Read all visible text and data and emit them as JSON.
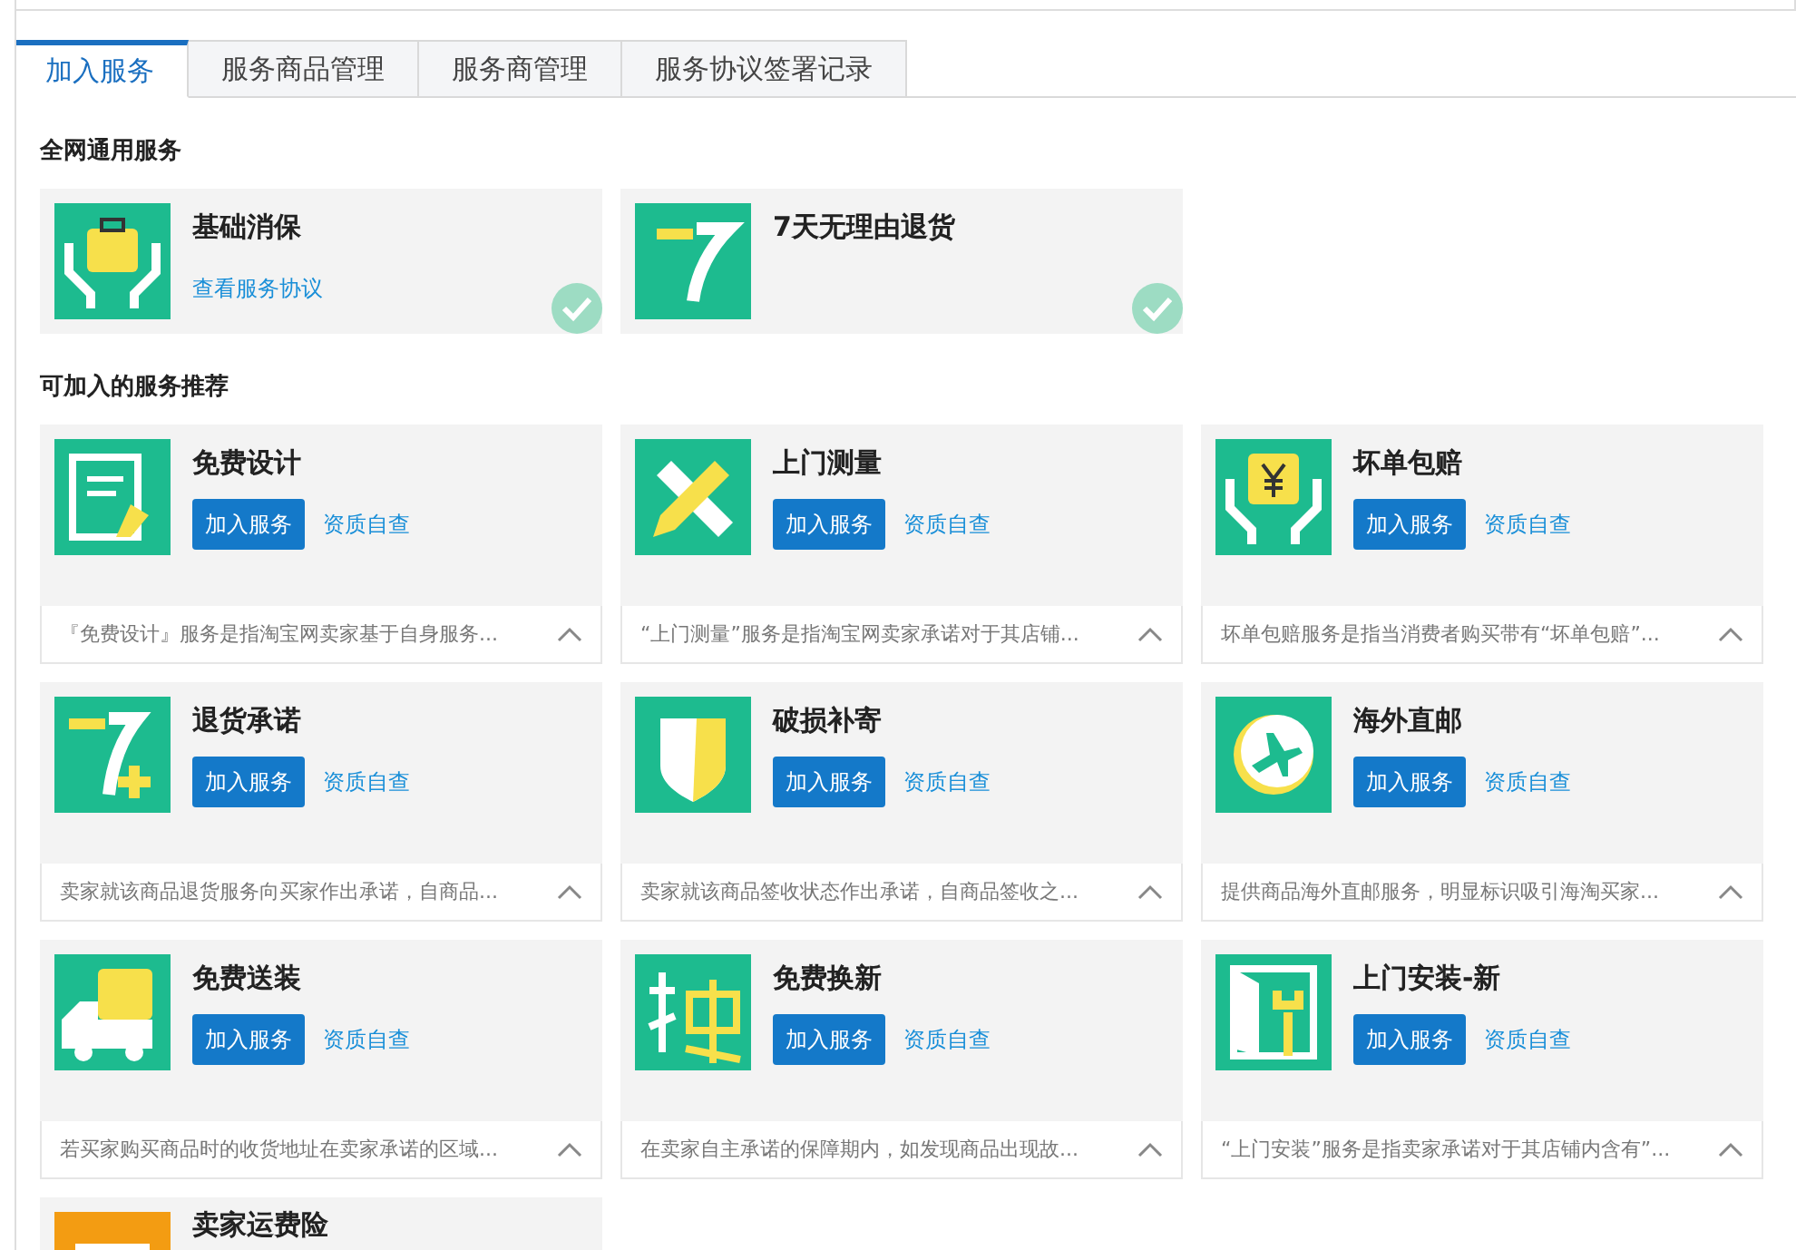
{
  "tabs": [
    {
      "label": "加入服务",
      "selected": true
    },
    {
      "label": "服务商品管理",
      "selected": false
    },
    {
      "label": "服务商管理",
      "selected": false
    },
    {
      "label": "服务协议签署记录",
      "selected": false
    }
  ],
  "general_section": {
    "title": "全网通用服务",
    "services": [
      {
        "name": "基础消保",
        "link": "查看服务协议",
        "joined": true
      },
      {
        "name": "7天无理由退货",
        "joined": true
      }
    ]
  },
  "recommended_section": {
    "title": "可加入的服务推荐",
    "services": [
      {
        "name": "免费设计",
        "join_button": "加入服务",
        "check_link": "资质自查",
        "description": "『免费设计』服务是指淘宝网卖家基于自身服务...",
        "expanded": true
      },
      {
        "name": "上门测量",
        "join_button": "加入服务",
        "check_link": "资质自查",
        "description": "“上门测量”服务是指淘宝网卖家承诺对于其店铺...",
        "expanded": true
      },
      {
        "name": "坏单包赔",
        "join_button": "加入服务",
        "check_link": "资质自查",
        "description": "坏单包赔服务是指当消费者购买带有“坏单包赔”...",
        "expanded": true
      },
      {
        "name": "退货承诺",
        "join_button": "加入服务",
        "check_link": "资质自查",
        "description": "卖家就该商品退货服务向买家作出承诺，自商品...",
        "expanded": true
      },
      {
        "name": "破损补寄",
        "join_button": "加入服务",
        "check_link": "资质自查",
        "description": "卖家就该商品签收状态作出承诺，自商品签收之...",
        "expanded": true
      },
      {
        "name": "海外直邮",
        "join_button": "加入服务",
        "check_link": "资质自查",
        "description": "提供商品海外直邮服务，明显标识吸引海淘买家...",
        "expanded": true
      },
      {
        "name": "免费送装",
        "join_button": "加入服务",
        "check_link": "资质自查",
        "description": "若买家购买商品时的收货地址在卖家承诺的区域...",
        "expanded": true
      },
      {
        "name": "免费换新",
        "join_button": "加入服务",
        "check_link": "资质自查",
        "description": "在卖家自主承诺的保障期内，如发现商品出现故...",
        "expanded": true
      },
      {
        "name": "上门安装-新",
        "join_button": "加入服务",
        "check_link": "资质自查",
        "description": "“上门安装”服务是指卖家承诺对于其店铺内含有”...",
        "expanded": true
      },
      {
        "name": "卖家运费险"
      }
    ]
  }
}
